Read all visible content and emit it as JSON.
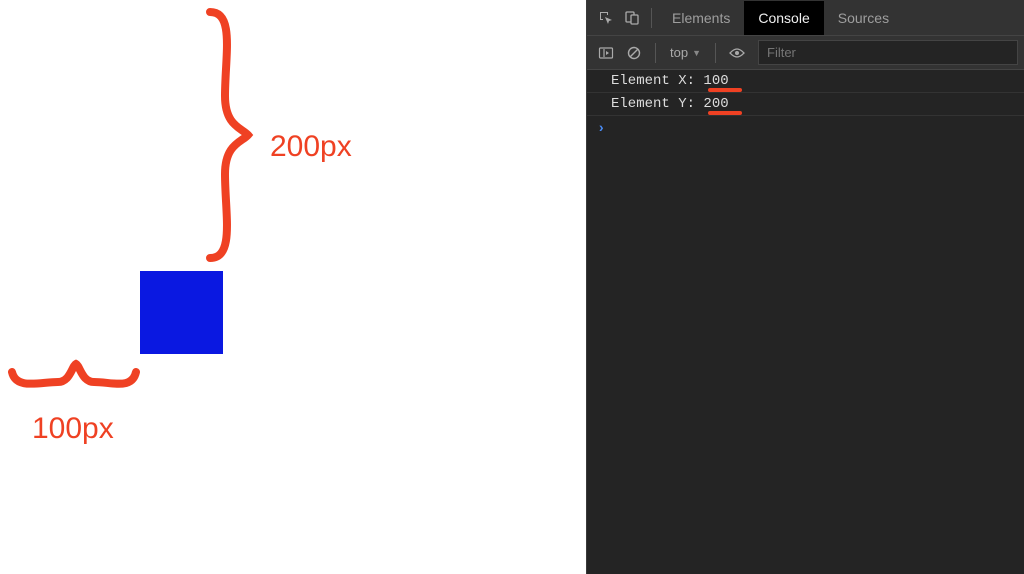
{
  "page": {
    "annotation_top_label": "200px",
    "annotation_left_label": "100px",
    "square_color": "#0a18e1"
  },
  "devtools": {
    "tabs": {
      "elements": "Elements",
      "console": "Console",
      "sources": "Sources"
    },
    "toolbar": {
      "context_label": "top",
      "filter_placeholder": "Filter"
    },
    "console": {
      "rows": [
        {
          "label": "Element X: ",
          "value": "100"
        },
        {
          "label": "Element Y: ",
          "value": "200"
        }
      ],
      "prompt_symbol": "›"
    }
  }
}
